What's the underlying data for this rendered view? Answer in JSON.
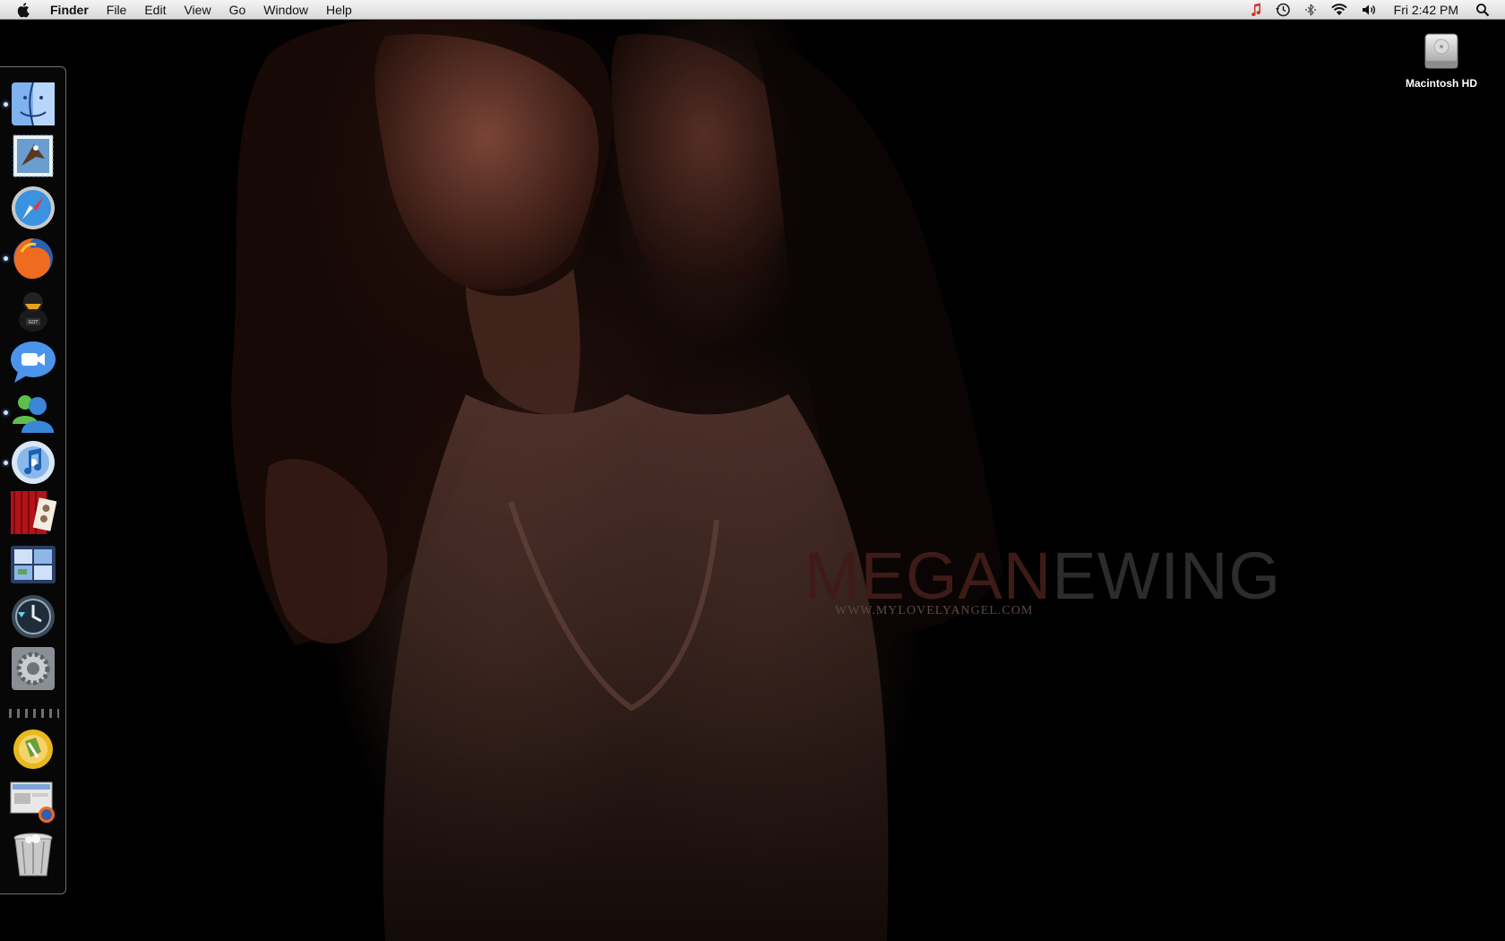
{
  "menubar": {
    "apple_icon": "apple-icon",
    "items": [
      "Finder",
      "File",
      "Edit",
      "View",
      "Go",
      "Window",
      "Help"
    ],
    "status_icons": [
      "music-note-icon",
      "time-machine-icon",
      "bluetooth-icon",
      "wifi-icon",
      "volume-icon"
    ],
    "clock": "Fri 2:42 PM",
    "spotlight_icon": "spotlight-search-icon"
  },
  "desktop": {
    "icons": [
      {
        "label": "Macintosh HD",
        "icon": "hard-drive-icon"
      }
    ]
  },
  "wallpaper": {
    "brand_first": "MEGAN",
    "brand_last": "EWING",
    "url": "WWW.MYLOVELYANGEL.COM"
  },
  "dock": {
    "items": [
      {
        "icon": "finder-icon",
        "running": true
      },
      {
        "icon": "mail-icon",
        "running": false
      },
      {
        "icon": "safari-icon",
        "running": false
      },
      {
        "icon": "firefox-icon",
        "running": true
      },
      {
        "icon": "adium-duck-icon",
        "running": false
      },
      {
        "icon": "ichat-icon",
        "running": false
      },
      {
        "icon": "messenger-icon",
        "running": true
      },
      {
        "icon": "itunes-icon",
        "running": true
      },
      {
        "icon": "photo-booth-icon",
        "running": false
      },
      {
        "icon": "spaces-icon",
        "running": false
      },
      {
        "icon": "time-machine-icon",
        "running": false
      },
      {
        "icon": "system-preferences-icon",
        "running": false
      },
      {
        "icon": "utility-app-icon",
        "running": false
      },
      {
        "icon": "downloads-stack-icon",
        "running": false
      },
      {
        "icon": "trash-icon",
        "running": false
      }
    ]
  }
}
